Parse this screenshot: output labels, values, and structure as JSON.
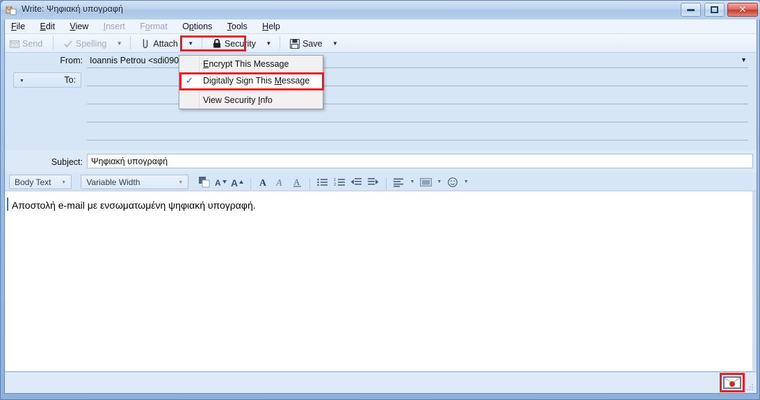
{
  "window": {
    "title": "Write: Ψηφιακή υπογραφή",
    "icon": "compose-mail-icon",
    "controls": {
      "minimize": "minimize-button",
      "maximize": "maximize-button",
      "close_glyph": "✕"
    }
  },
  "menubar": {
    "items": [
      {
        "label": "File",
        "accel": "F",
        "disabled": false
      },
      {
        "label": "Edit",
        "accel": "E",
        "disabled": false
      },
      {
        "label": "View",
        "accel": "V",
        "disabled": false
      },
      {
        "label": "Insert",
        "accel": "I",
        "disabled": true
      },
      {
        "label": "Format",
        "accel": "o",
        "disabled": true
      },
      {
        "label": "Options",
        "accel": "O",
        "disabled": false
      },
      {
        "label": "Tools",
        "accel": "T",
        "disabled": false
      },
      {
        "label": "Help",
        "accel": "H",
        "disabled": false
      }
    ]
  },
  "compose_toolbar": {
    "send": {
      "label": "Send",
      "disabled": true
    },
    "spelling": {
      "label": "Spelling",
      "disabled": true
    },
    "attach": {
      "label": "Attach",
      "disabled": false
    },
    "security": {
      "label": "Security",
      "disabled": false,
      "highlighted": true
    },
    "save": {
      "label": "Save",
      "disabled": false
    }
  },
  "security_menu": {
    "visible": true,
    "items": [
      {
        "label": "Encrypt This Message",
        "checked": false,
        "highlighted": false
      },
      {
        "label": "Digitally Sign This Message",
        "checked": true,
        "highlighted": true,
        "check_glyph": "✓"
      },
      {
        "label": "View Security Info",
        "checked": false,
        "highlighted": false
      }
    ]
  },
  "header": {
    "from": {
      "label": "From:",
      "value": "Ioannis Petrou <sdi09000"
    },
    "recipient": {
      "label": "To:",
      "value": ""
    },
    "extra_rows": 3
  },
  "subject": {
    "label": "Subject:",
    "value": "Ψηφιακή υπογραφή",
    "placeholder": ""
  },
  "format_toolbar": {
    "paragraph_style": {
      "value": "Body Text"
    },
    "font_family": {
      "value": "Variable Width"
    },
    "buttons": [
      {
        "name": "text-color-swatch",
        "glyph": ""
      },
      {
        "name": "decrease-font-size-icon",
        "glyph": "A"
      },
      {
        "name": "increase-font-size-icon",
        "glyph": "A"
      },
      {
        "name": "bold-icon",
        "glyph": "A"
      },
      {
        "name": "italic-icon",
        "glyph": "A"
      },
      {
        "name": "underline-icon",
        "glyph": "A"
      },
      {
        "name": "bullet-list-icon",
        "glyph": "☰"
      },
      {
        "name": "numbered-list-icon",
        "glyph": "☰"
      },
      {
        "name": "outdent-icon",
        "glyph": "⇤"
      },
      {
        "name": "indent-icon",
        "glyph": "⇥"
      },
      {
        "name": "align-icon",
        "glyph": "≡"
      },
      {
        "name": "insert-image-icon",
        "glyph": "▣"
      },
      {
        "name": "insert-smiley-icon",
        "glyph": "☺"
      }
    ]
  },
  "body": {
    "text": "Αποστολή e-mail με ενσωματωμένη ψηφιακή υπογραφή."
  },
  "statusbar": {
    "signature_indicator": {
      "name": "signed-message-icon",
      "highlighted": true,
      "tooltip": ""
    }
  },
  "colors": {
    "highlight_red": "#ec1c24",
    "header_blue": "#d7e6f6",
    "body_white": "#ffffff",
    "check_blue": "#1c5fb0"
  }
}
